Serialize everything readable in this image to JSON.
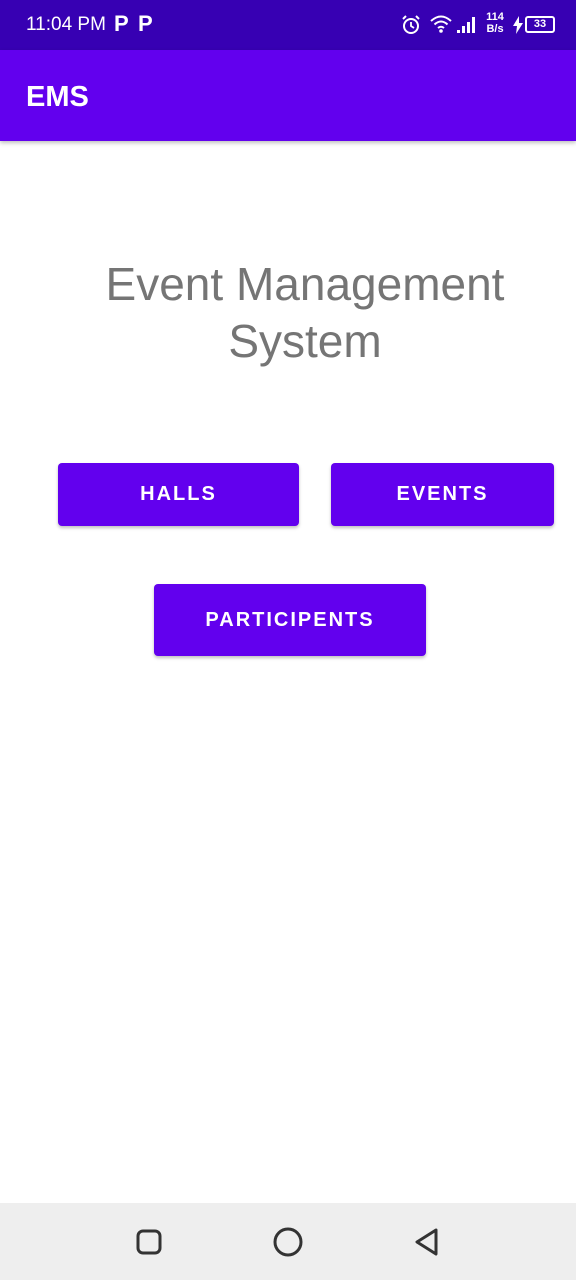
{
  "status_bar": {
    "time": "11:04 PM",
    "notif_1": "P",
    "notif_2": "P",
    "net_speed_value": "114",
    "net_speed_unit": "B/s",
    "battery_level": "33",
    "icons": [
      "alarm-icon",
      "wifi-icon",
      "signal-icon",
      "charging-bolt-icon",
      "battery-icon"
    ]
  },
  "app_bar": {
    "title": "EMS"
  },
  "main": {
    "heading": "Event Management System",
    "buttons": {
      "halls": "HALLS",
      "events": "EVENTS",
      "participents": "PARTICIPENTS"
    }
  },
  "nav_bar": {
    "icons": [
      "recents-icon",
      "home-icon",
      "back-icon"
    ]
  },
  "colors": {
    "status_bar": "#3700b3",
    "primary": "#6200ee",
    "heading_text": "#757575",
    "nav_bar": "#eeeeee"
  }
}
